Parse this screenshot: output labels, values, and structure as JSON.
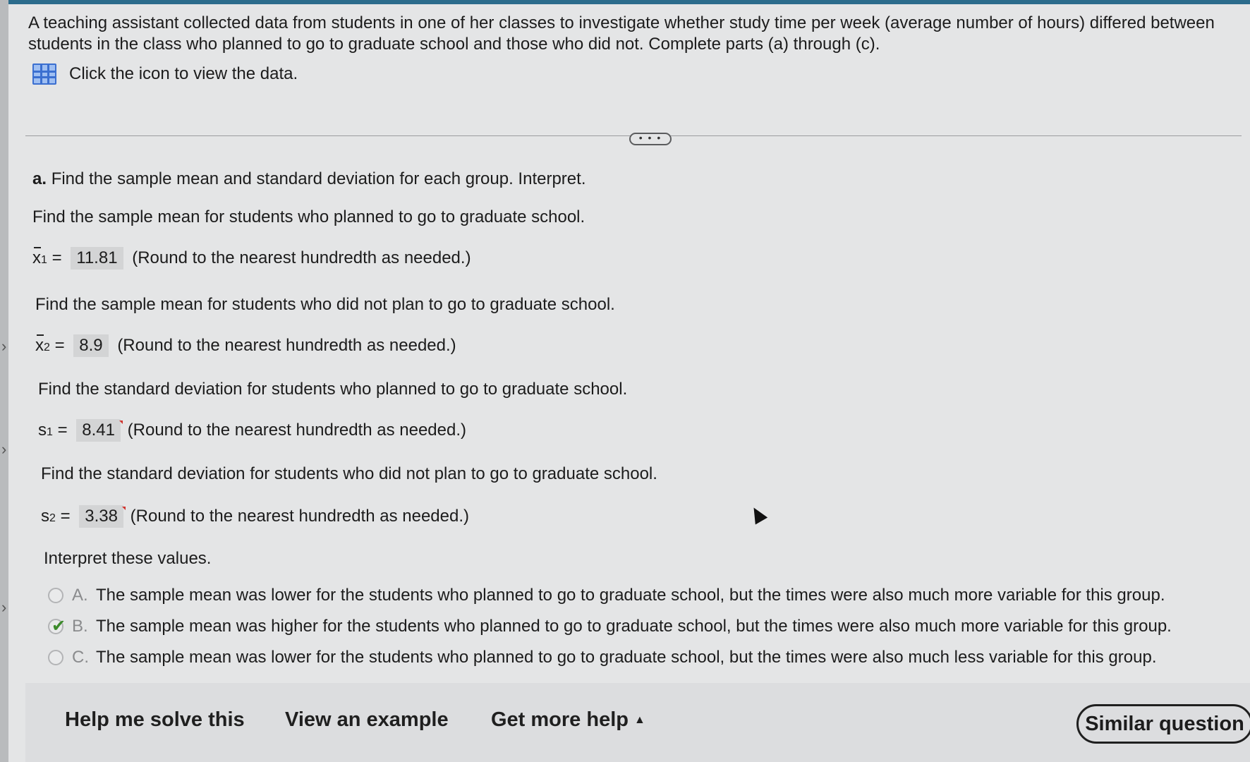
{
  "problem": {
    "text": "A teaching assistant collected data from students in one of her classes to investigate whether study time per week (average number of hours) differed between students in the class who planned to go to graduate school and those who did not. Complete parts (a) through (c).",
    "data_link_label": "Click the icon to view the data.",
    "more_label": "• • •"
  },
  "part_a": {
    "letter": "a.",
    "heading": "Find the sample mean and standard deviation for each group. Interpret.",
    "q1": "Find the sample mean for students who planned to go to graduate school.",
    "x1_var": "x",
    "x1_sub": "1",
    "x1_value": "11.81",
    "q2": "Find the sample mean for students who did not plan to go to graduate school.",
    "x2_var": "x",
    "x2_sub": "2",
    "x2_value": "8.9",
    "q3": "Find the standard deviation for students who planned to go to graduate school.",
    "s1_var": "s",
    "s1_sub": "1",
    "s1_value": "8.41",
    "q4": "Find the standard deviation for students who did not plan to go to graduate school.",
    "s2_var": "s",
    "s2_sub": "2",
    "s2_value": "3.38",
    "equals": "=",
    "round_hint": "(Round to the nearest hundredth as needed.)",
    "interpret_prompt": "Interpret these values.",
    "choices": [
      {
        "letter": "A.",
        "text": "The sample mean was lower for the students who planned to go to graduate school, but the times were also much more variable for this group.",
        "selected": false
      },
      {
        "letter": "B.",
        "text": "The sample mean was higher for the students who planned to go to graduate school, but the times were also much more variable for this group.",
        "selected": true
      },
      {
        "letter": "C.",
        "text": "The sample mean was lower for the students who planned to go to graduate school, but the times were also much less variable for this group.",
        "selected": false
      }
    ]
  },
  "footer": {
    "help_label": "Help me solve this",
    "example_label": "View an example",
    "more_help_label": "Get more help",
    "more_help_caret": "▲",
    "similar_label": "Similar question"
  },
  "icons": {
    "data": "grid-icon",
    "check": "check-icon",
    "chevron": "chevron-right-icon",
    "cursor": "cursor-icon"
  },
  "colors": {
    "check": "#3b8a2a",
    "icon_blue": "#3b6fd0",
    "flag": "#d0332d"
  }
}
